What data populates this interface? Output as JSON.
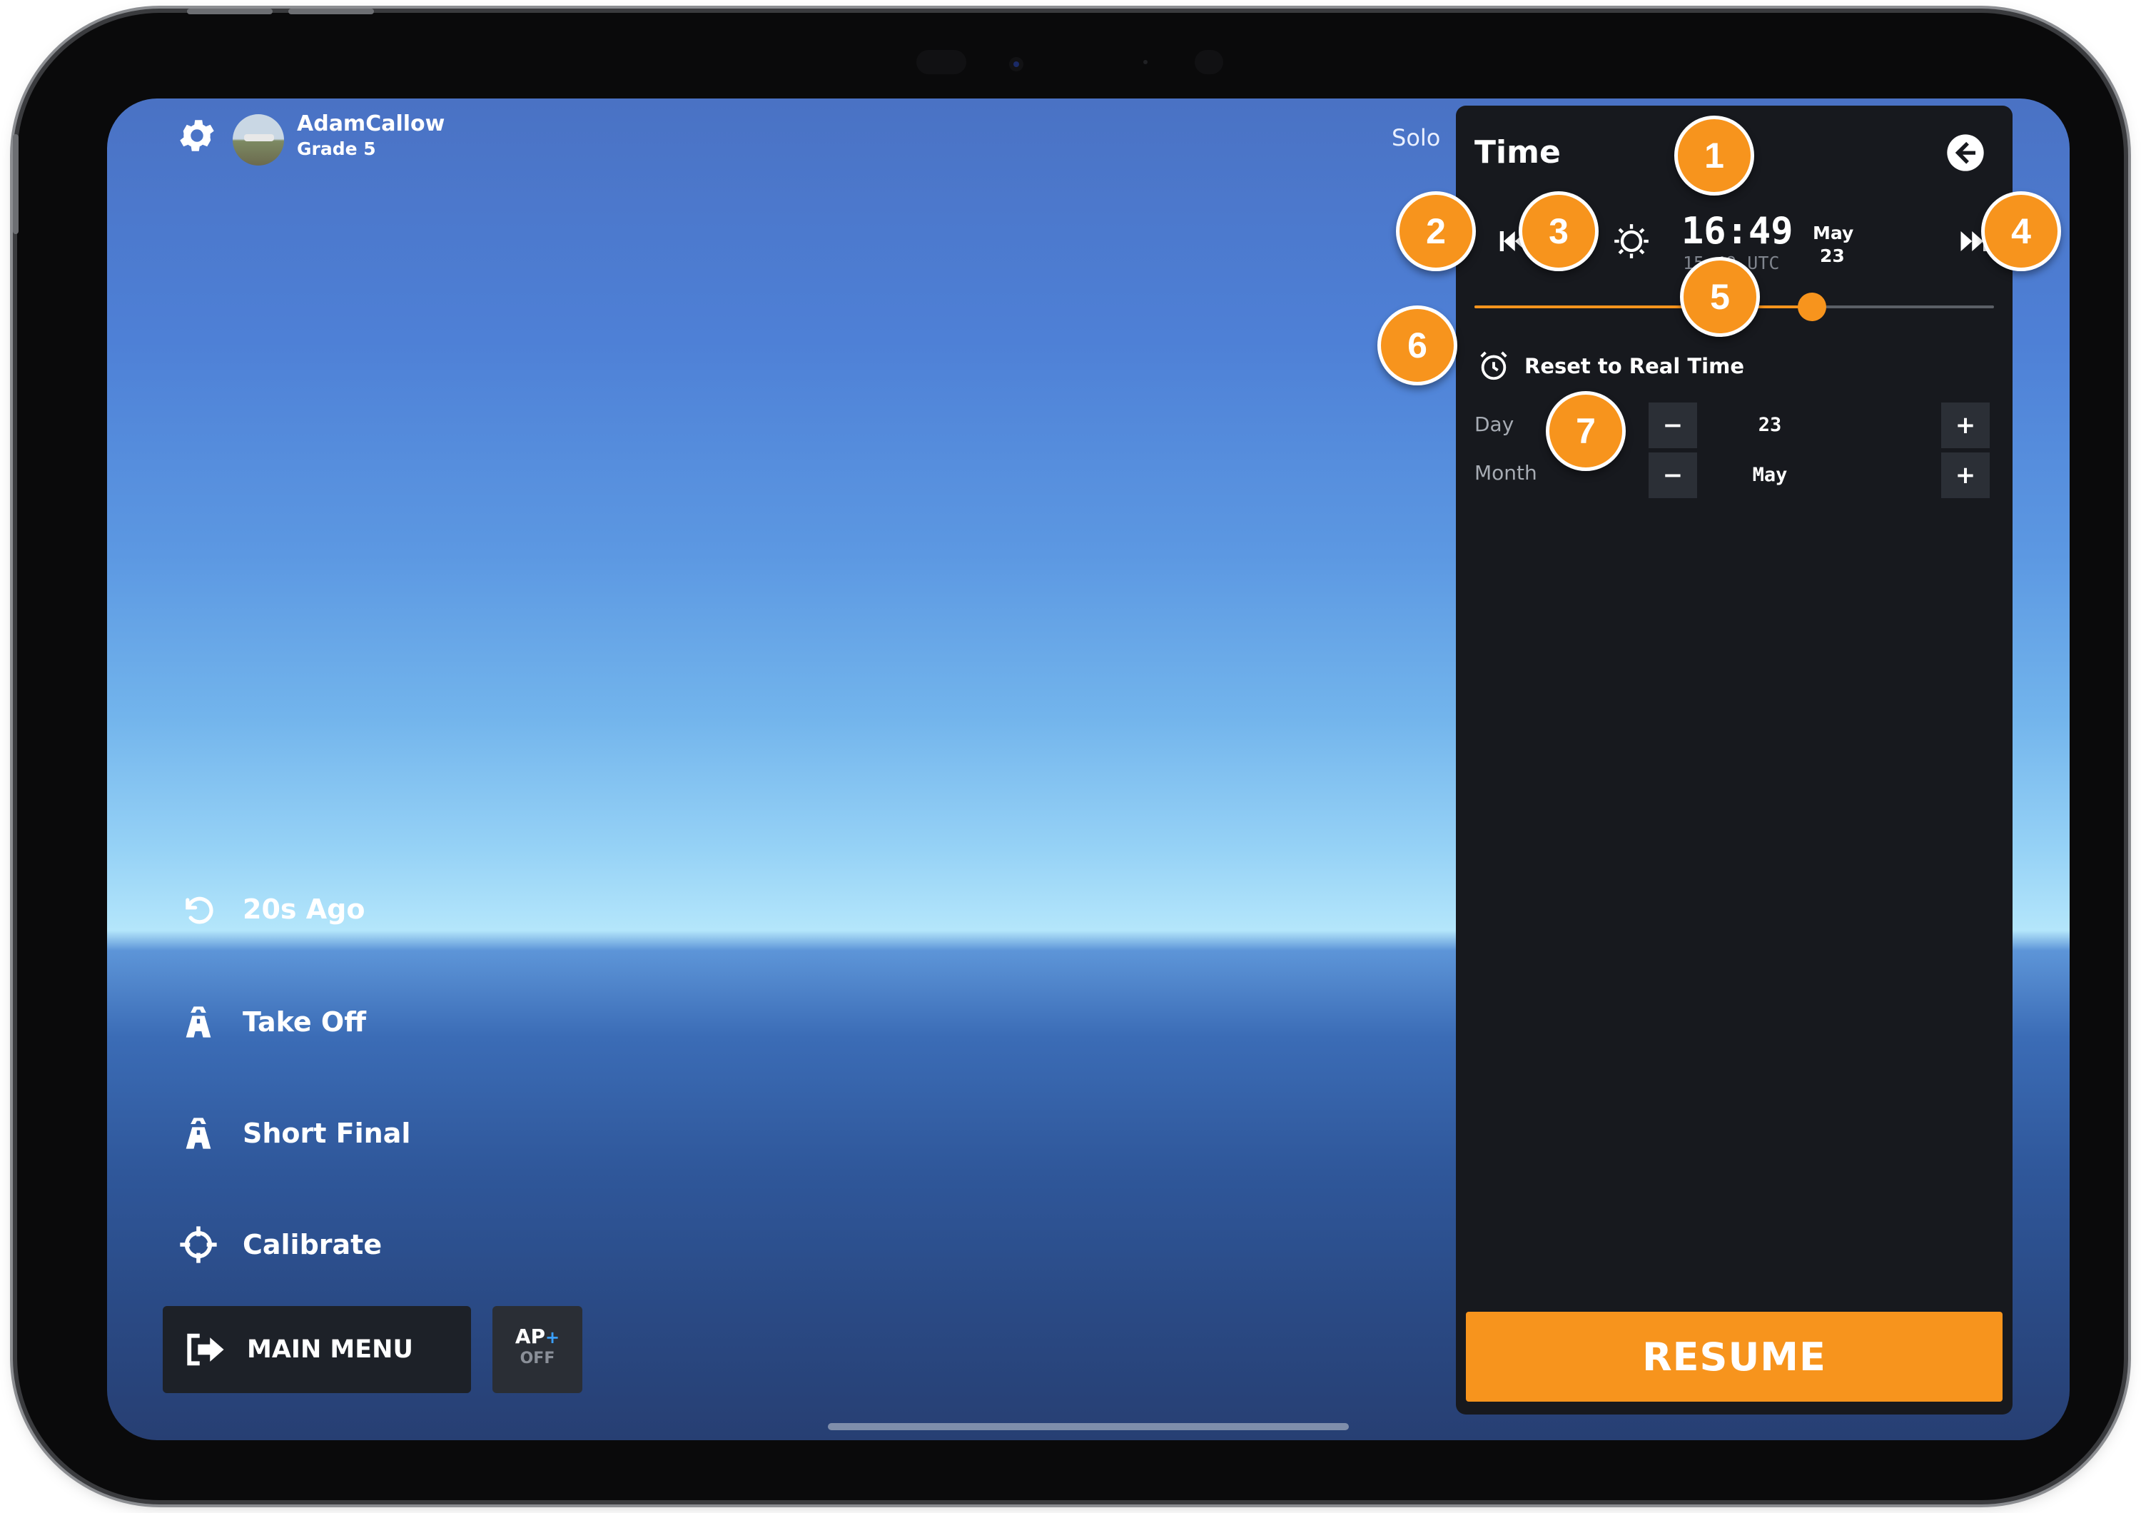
{
  "user": {
    "name": "AdamCallow",
    "grade": "Grade 5"
  },
  "mode": "Solo",
  "left_menu": [
    {
      "label": "20s Ago",
      "icon": "rewind-icon"
    },
    {
      "label": "Take Off",
      "icon": "runway-icon"
    },
    {
      "label": "Short Final",
      "icon": "runway-icon"
    },
    {
      "label": "Calibrate",
      "icon": "crosshair-icon"
    }
  ],
  "main_menu_label": "MAIN MENU",
  "ap": {
    "label": "AP",
    "plus": "+",
    "state": "OFF"
  },
  "time_panel": {
    "title": "Time",
    "local_time": "16:49",
    "utc_time": "15:49 UTC",
    "date_month": "May",
    "date_day": "23",
    "slider_position": 0.65,
    "reset_label": "Reset to Real Time",
    "day_label": "Day",
    "day_value": "23",
    "month_label": "Month",
    "month_value": "May",
    "minus": "−",
    "plus": "+",
    "resume_label": "RESUME"
  },
  "callouts": [
    "1",
    "2",
    "3",
    "4",
    "5",
    "6",
    "7"
  ],
  "colors": {
    "accent": "#f7941d",
    "panel": "#17191e",
    "stepper": "#2b2f36"
  }
}
